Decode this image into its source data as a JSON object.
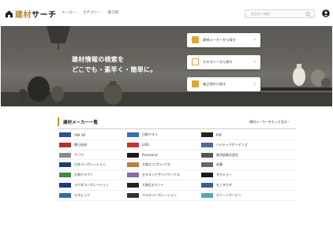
{
  "header": {
    "logo_icon": "house-icon",
    "logo_main": "建材",
    "logo_sub": "サーチ",
    "nav": [
      "メーカー",
      "カテゴリー",
      "施工例"
    ],
    "search_placeholder": "商品名で検索",
    "search_icon": "search-icon",
    "user_icon": "user-icon"
  },
  "hero": {
    "line1": "建材情報の検索を",
    "line2": "どこでも・素早く・簡単に。",
    "cards": [
      {
        "label": "建材メーカーから探す",
        "icon": "factory-icon"
      },
      {
        "label": "カテゴリーから探す",
        "icon": "category-icon"
      },
      {
        "label": "施工例から探す",
        "icon": "photo-icon"
      }
    ]
  },
  "makers": {
    "title": "建材メーカー一覧",
    "more": "建材メーカーをもっと見る",
    "items": [
      [
        "YKK AP",
        "日新アルミ",
        "PSF"
      ],
      [
        "朝日化成",
        "LIXIL",
        "ハイテックボーデンズ"
      ],
      [
        "サンワ",
        "Panasonic",
        "東洋紡株式会社"
      ],
      [
        "日本コーポレーション",
        "大和エコプロックス",
        "佐藤"
      ],
      [
        "大和クラフト",
        "セキスイデザインワークス",
        "タカショー"
      ],
      [
        "ラクダコーポレーション",
        "大和石セメント",
        "丸三タカギ"
      ],
      [
        "エスビック",
        "マルキコーポレーション",
        "グリーンガーデン"
      ]
    ],
    "logo_colors": [
      [
        "#2b4fa0",
        "#3a6db5",
        "#222222"
      ],
      [
        "#b03030",
        "#c8302c",
        "#4a6c9c"
      ],
      [
        "#8a8a8a",
        "#1a1a1a",
        "#555555"
      ],
      [
        "#1f3b7a",
        "#c87a3a",
        "#666666"
      ],
      [
        "#3f8a4a",
        "#8a6aa8",
        "#1a1a1a"
      ],
      [
        "#1a3a8a",
        "#222222",
        "#3060a0"
      ],
      [
        "#2f6fa8",
        "#333333",
        "#5aa0c0"
      ]
    ]
  }
}
